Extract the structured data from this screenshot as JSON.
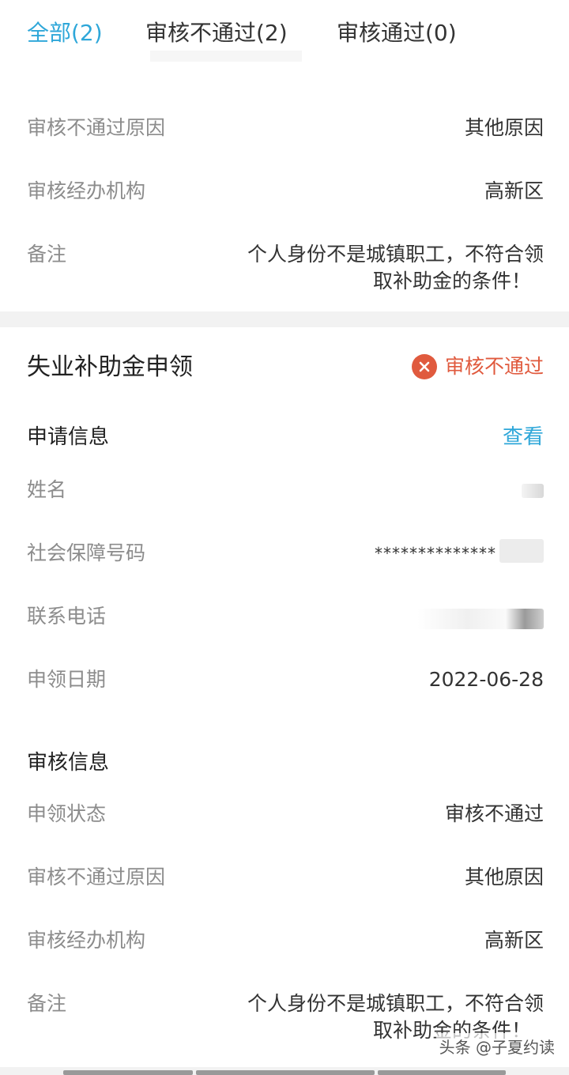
{
  "tabs": [
    {
      "label": "全部(2)",
      "active": true
    },
    {
      "label": "审核不通过(2)",
      "active": false
    },
    {
      "label": "审核通过(0)",
      "active": false
    }
  ],
  "top_card": {
    "rows": [
      {
        "label": "审核不通过原因",
        "value": "其他原因"
      },
      {
        "label": "审核经办机构",
        "value": "高新区"
      }
    ],
    "remark_label": "备注",
    "remark_line1": "个人身份不是城镇职工，不符合领",
    "remark_line2": "取补助金的条件！"
  },
  "main_card": {
    "title": "失业补助金申领",
    "status": "审核不通过",
    "status_color": "#e05a3e",
    "apply_section": {
      "title": "申请信息",
      "view_link": "查看",
      "rows": [
        {
          "label": "姓名",
          "value": ""
        },
        {
          "label": "社会保障号码",
          "value": "**************"
        },
        {
          "label": "联系电话",
          "value": ""
        },
        {
          "label": "申领日期",
          "value": "2022-06-28"
        }
      ]
    },
    "review_section": {
      "title": "审核信息",
      "rows": [
        {
          "label": "申领状态",
          "value": "审核不通过"
        },
        {
          "label": "审核不通过原因",
          "value": "其他原因"
        },
        {
          "label": "审核经办机构",
          "value": "高新区"
        }
      ],
      "remark_label": "备注",
      "remark_line1": "个人身份不是城镇职工，不符合领",
      "remark_line2": "取补助金的条件！"
    }
  },
  "watermark": "头条 @子夏约读",
  "accent_color": "#2ea7d9"
}
